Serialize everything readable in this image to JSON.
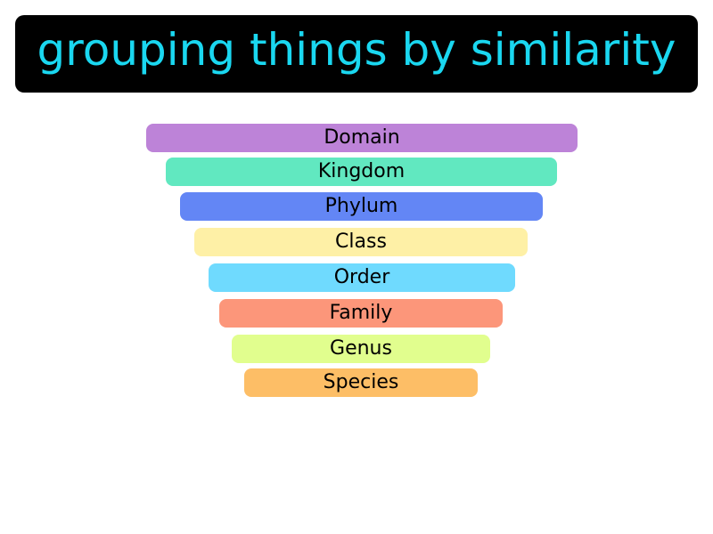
{
  "title": "grouping things by similarity",
  "colors": {
    "banner_bg": "#000000",
    "banner_text": "#1ad7f0",
    "label_text": "#000000"
  },
  "levels": [
    {
      "label": "Domain",
      "color": "#bd83d8"
    },
    {
      "label": "Kingdom",
      "color": "#61e8c0"
    },
    {
      "label": "Phylum",
      "color": "#6386f5"
    },
    {
      "label": "Class",
      "color": "#fef0a6"
    },
    {
      "label": "Order",
      "color": "#6fdafe"
    },
    {
      "label": "Family",
      "color": "#fc967a"
    },
    {
      "label": "Genus",
      "color": "#e1fe8e"
    },
    {
      "label": "Species",
      "color": "#fdbe66"
    }
  ]
}
